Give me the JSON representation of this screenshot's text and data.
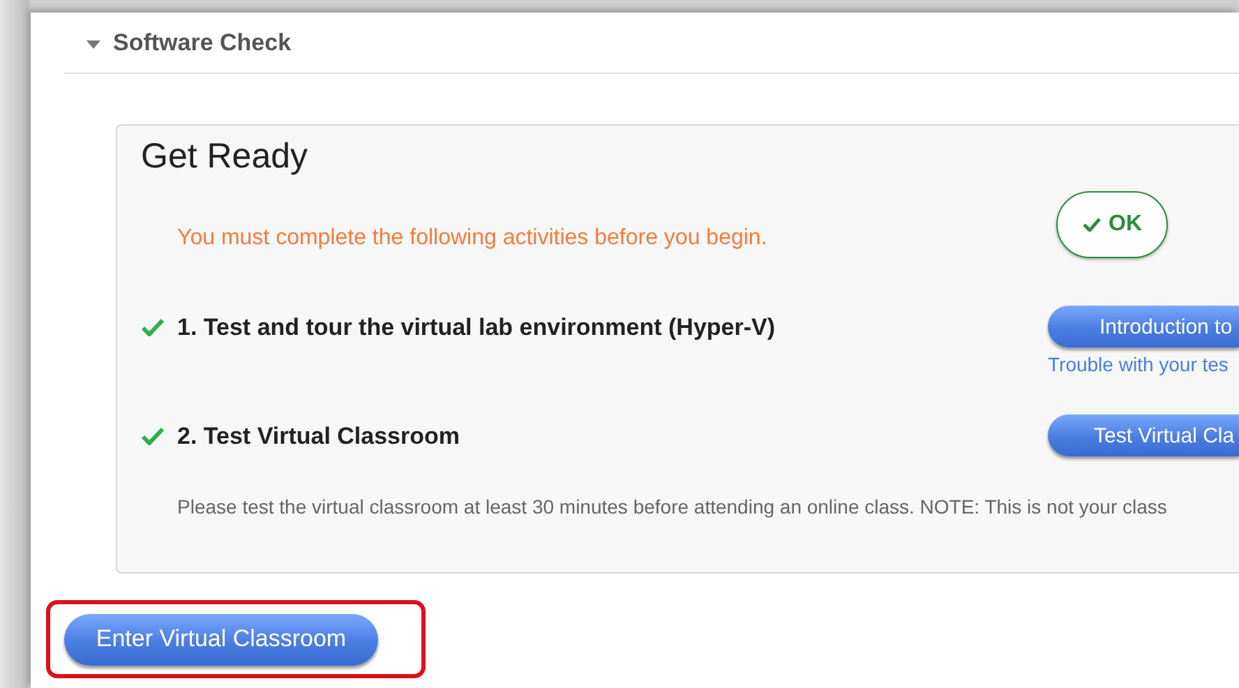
{
  "section": {
    "title": "Software Check",
    "expanded": true
  },
  "card": {
    "title": "Get Ready",
    "notice": "You must complete the following activities before you begin.",
    "ok_button": "OK",
    "activities": [
      {
        "label": "1. Test and tour the virtual lab environment (Hyper-V)",
        "completed": true,
        "button": "Introduction to",
        "link": "Trouble with your tes"
      },
      {
        "label": "2. Test Virtual Classroom",
        "completed": true,
        "button": "Test Virtual Cla",
        "note": "Please test the virtual classroom at least 30 minutes before attending an online class. NOTE: This is not your class"
      }
    ]
  },
  "enter_button": {
    "label": "Enter Virtual Classroom",
    "highlighted": true
  }
}
